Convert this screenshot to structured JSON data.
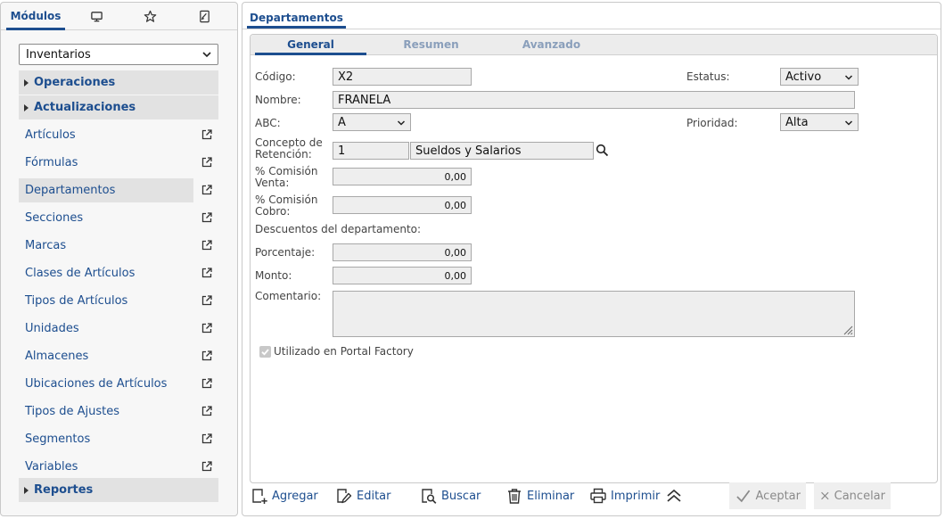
{
  "left": {
    "tabs": {
      "modules_label": "Módulos"
    },
    "module_select": {
      "value": "Inventarios"
    },
    "groups": {
      "operaciones": "Operaciones",
      "actualizaciones": "Actualizaciones",
      "reportes": "Reportes"
    },
    "items": [
      "Artículos",
      "Fórmulas",
      "Departamentos",
      "Secciones",
      "Marcas",
      "Clases de Artículos",
      "Tipos de Artículos",
      "Unidades",
      "Almacenes",
      "Ubicaciones de Artículos",
      "Tipos de Ajustes",
      "Segmentos",
      "Variables"
    ],
    "selected_item": "Departamentos"
  },
  "main": {
    "tab_title": "Departamentos",
    "subtabs": [
      "General",
      "Resumen",
      "Avanzado"
    ],
    "active_subtab": "General",
    "form": {
      "codigo": {
        "label": "Código:",
        "value": "X2"
      },
      "estatus": {
        "label": "Estatus:",
        "value": "Activo"
      },
      "nombre": {
        "label": "Nombre:",
        "value": "FRANELA"
      },
      "abc": {
        "label": "ABC:",
        "value": "A"
      },
      "prioridad": {
        "label": "Prioridad:",
        "value": "Alta"
      },
      "concepto": {
        "label_1": "Concepto de",
        "label_2": "Retención:",
        "code": "1",
        "description": "Sueldos y Salarios"
      },
      "comision_venta": {
        "label_1": "% Comisión",
        "label_2": "Venta:",
        "value": "0,00"
      },
      "comision_cobro": {
        "label_1": "% Comisión",
        "label_2": "Cobro:",
        "value": "0,00"
      },
      "descuentos_title": "Descuentos del departamento:",
      "porcentaje": {
        "label": "Porcentaje:",
        "value": "0,00"
      },
      "monto": {
        "label": "Monto:",
        "value": "0,00"
      },
      "comentario": {
        "label": "Comentario:",
        "value": ""
      },
      "portal_factory": {
        "label": "Utilizado en Portal Factory",
        "checked": true
      }
    }
  },
  "toolbar": {
    "agregar": "Agregar",
    "editar": "Editar",
    "buscar": "Buscar",
    "eliminar": "Eliminar",
    "imprimir": "Imprimir",
    "aceptar": "Aceptar",
    "cancelar": "Cancelar"
  },
  "colors": {
    "accent": "#1d4e8f",
    "group_bg": "#e2e2e2",
    "field_bg": "#eeeeee",
    "disabled_text": "#8a8a8a"
  }
}
